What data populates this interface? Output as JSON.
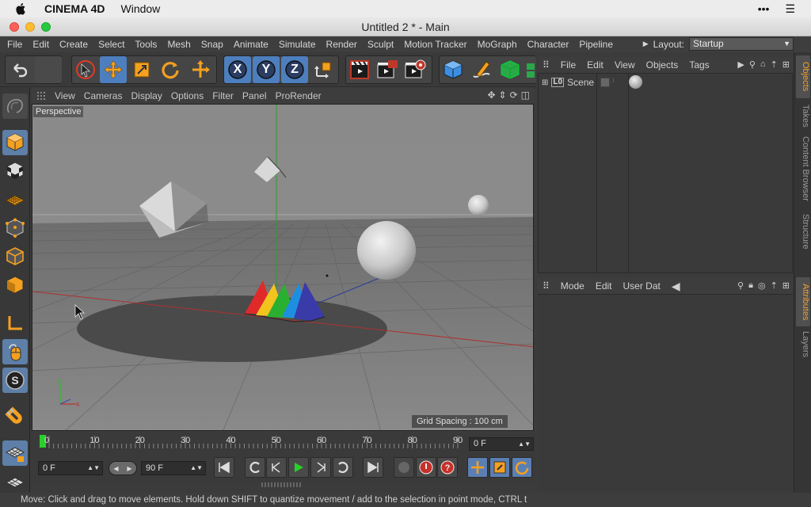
{
  "mac_menubar": {
    "app_name": "CINEMA 4D",
    "menu": "Window"
  },
  "window": {
    "title": "Untitled 2 * - Main"
  },
  "app_menu": [
    "File",
    "Edit",
    "Create",
    "Select",
    "Tools",
    "Mesh",
    "Snap",
    "Animate",
    "Simulate",
    "Render",
    "Sculpt",
    "Motion Tracker",
    "MoGraph",
    "Character",
    "Pipeline"
  ],
  "layout": {
    "label": "Layout:",
    "value": "Startup"
  },
  "viewport": {
    "menu": [
      "View",
      "Cameras",
      "Display",
      "Options",
      "Filter",
      "Panel",
      "ProRender"
    ],
    "camera_label": "Perspective",
    "grid_spacing": "Grid Spacing : 100 cm"
  },
  "toolbar": {
    "axis_x": "X",
    "axis_y": "Y",
    "axis_z": "Z"
  },
  "timeline": {
    "ticks": [
      "0",
      "10",
      "20",
      "30",
      "40",
      "50",
      "60",
      "70",
      "80",
      "90"
    ],
    "current_frame": "0 F"
  },
  "transport": {
    "start_frame": "0 F",
    "end_frame": "90 F"
  },
  "object_manager": {
    "menu": [
      "File",
      "Edit",
      "View",
      "Objects",
      "Tags"
    ],
    "items": [
      {
        "name": "Scene"
      }
    ]
  },
  "attributes": {
    "menu": [
      "Mode",
      "Edit",
      "User Dat"
    ]
  },
  "right_tabs": {
    "top": [
      "Objects",
      "Takes",
      "Content Browser",
      "Structure"
    ],
    "bottom": [
      "Attributes",
      "Layers"
    ]
  },
  "status": "Move: Click and drag to move elements. Hold down SHIFT to quantize movement / add to the selection in point mode, CTRL t",
  "colors": {
    "accent": "#4d7fbf",
    "active_tab": "#f0a030"
  }
}
